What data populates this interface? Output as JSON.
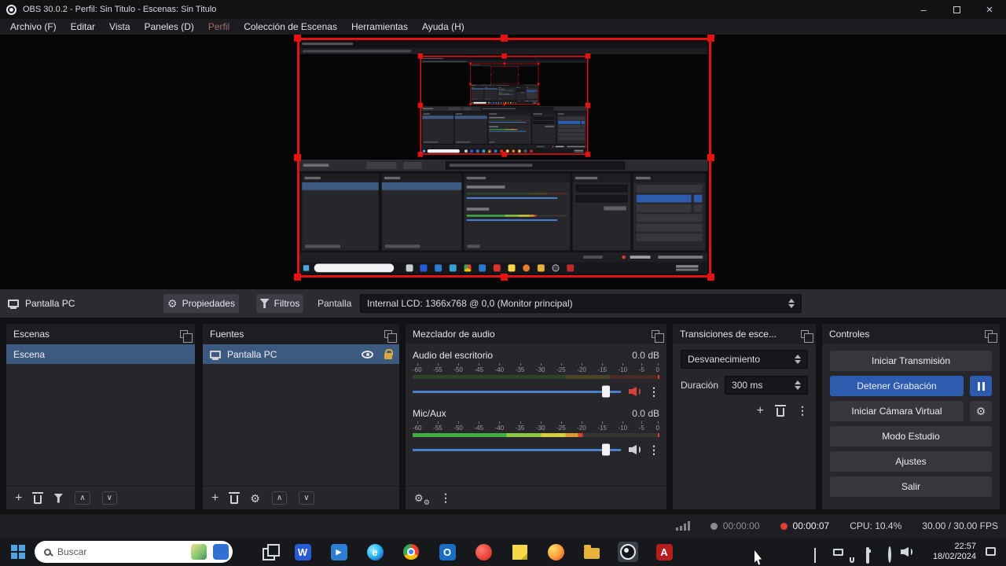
{
  "colors": {
    "capture_red": "#e51212",
    "selection_blue": "#3c5a80",
    "accent_blue": "#2d5cae",
    "slider_blue": "#4a7dcb",
    "record_red": "#de3c34",
    "lock_gold": "#d8a93c",
    "meter_green": "#3fae3f",
    "meter_yellow": "#d7cf3a",
    "meter_orange": "#e09a32",
    "meter_red": "#d8442e"
  },
  "window": {
    "title": "OBS 30.0.2 - Perfil: Sin Titulo - Escenas: Sin Titulo",
    "minimize_glyph": "–",
    "close_glyph": "×"
  },
  "menu": {
    "items": [
      "Archivo (F)",
      "Editar",
      "Vista",
      "Paneles (D)",
      "Perfil",
      "Colección de Escenas",
      "Herramientas",
      "Ayuda (H)"
    ]
  },
  "source_toolbar": {
    "source_name": "Pantalla PC",
    "properties_label": "Propiedades",
    "filters_label": "Filtros",
    "display_label": "Pantalla",
    "display_value": "Internal LCD: 1366x768 @ 0,0 (Monitor principal)"
  },
  "panels": {
    "scenes": {
      "title": "Escenas",
      "items": [
        "Escena"
      ]
    },
    "sources": {
      "title": "Fuentes",
      "items": [
        "Pantalla PC"
      ]
    },
    "mixer": {
      "title": "Mezclador de audio",
      "scale": [
        "-60",
        "-55",
        "-50",
        "-45",
        "-40",
        "-35",
        "-30",
        "-25",
        "-20",
        "-15",
        "-10",
        "-5",
        "0"
      ],
      "channels": [
        {
          "name": "Audio del escritorio",
          "level": "0.0 dB",
          "muted": true
        },
        {
          "name": "Mic/Aux",
          "level": "0.0 dB",
          "muted": false
        }
      ]
    },
    "transitions": {
      "title": "Transiciones de esce...",
      "transition": "Desvanecimiento",
      "duration_label": "Duración",
      "duration_value": "300 ms"
    },
    "controls": {
      "title": "Controles",
      "buttons": {
        "start_stream": "Iniciar Transmisión",
        "stop_record": "Detener Grabación",
        "virtual_cam": "Iniciar Cámara Virtual",
        "studio_mode": "Modo Estudio",
        "settings": "Ajustes",
        "exit": "Salir"
      }
    }
  },
  "status_bar": {
    "stream_time": "00:00:00",
    "record_time": "00:00:07",
    "cpu": "CPU: 10.4%",
    "fps": "30.00 / 30.00 FPS"
  },
  "taskbar": {
    "search_placeholder": "Buscar",
    "clock_time": "22:57",
    "clock_date": "18/02/2024",
    "app_glyphs": {
      "word": "W",
      "media": "▶",
      "edge": "e",
      "outlook": "O",
      "acrobat": "A"
    }
  }
}
